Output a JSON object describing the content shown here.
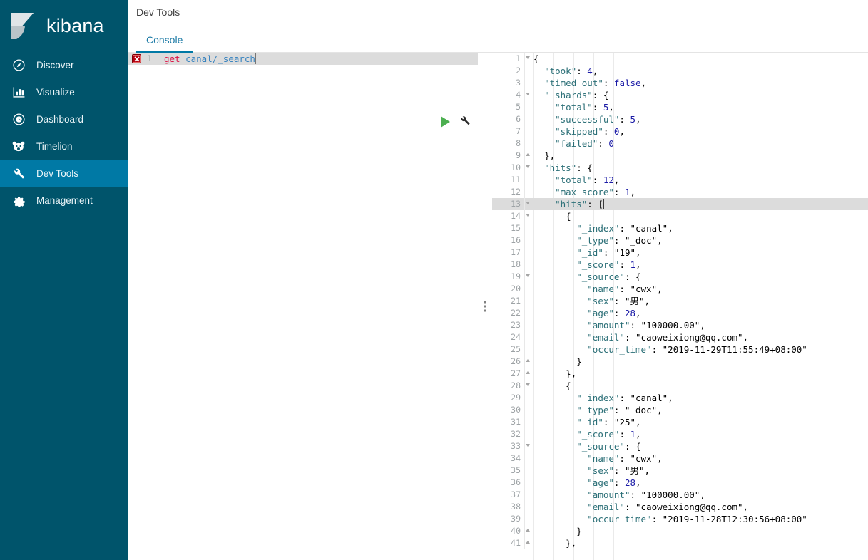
{
  "sidebar": {
    "brand": "kibana",
    "brand_icon": "kibana-logo-icon",
    "bg_color": "#00546b",
    "active_color": "#0079a5",
    "items": [
      {
        "label": "Discover",
        "icon": "compass-icon",
        "active": false
      },
      {
        "label": "Visualize",
        "icon": "bar-chart-icon",
        "active": false
      },
      {
        "label": "Dashboard",
        "icon": "clock-circle-icon",
        "active": false
      },
      {
        "label": "Timelion",
        "icon": "bear-face-icon",
        "active": false
      },
      {
        "label": "Dev Tools",
        "icon": "wrench-icon",
        "active": true
      },
      {
        "label": "Management",
        "icon": "gear-icon",
        "active": false
      }
    ]
  },
  "header": {
    "page_title": "Dev Tools"
  },
  "tabs": [
    {
      "label": "Console",
      "active": true
    }
  ],
  "request_editor": {
    "actions": {
      "play_label": "play-icon",
      "wrench_label": "wrench-icon"
    },
    "error_marker": {
      "icon": "error-x-icon",
      "line": "1"
    },
    "lines": [
      {
        "num": "1",
        "active": true,
        "error": true,
        "tokens": [
          {
            "t": "get ",
            "c": "hl-method"
          },
          {
            "t": "canal/_search",
            "c": "hl-url"
          }
        ],
        "cursor": true
      }
    ]
  },
  "splitter": {
    "handle_icon": "drag-handle-icon"
  },
  "response_editor": {
    "lines": [
      {
        "num": "1",
        "fold": "down",
        "indent": 0,
        "tokens": [
          {
            "t": "{",
            "c": "tk-punc"
          }
        ]
      },
      {
        "num": "2",
        "fold": "",
        "indent": 1,
        "tokens": [
          {
            "t": "\"took\"",
            "c": "tk-key"
          },
          {
            "t": ": ",
            "c": "tk-punc"
          },
          {
            "t": "4",
            "c": "tk-num"
          },
          {
            "t": ",",
            "c": "tk-punc"
          }
        ]
      },
      {
        "num": "3",
        "fold": "",
        "indent": 1,
        "tokens": [
          {
            "t": "\"timed_out\"",
            "c": "tk-key"
          },
          {
            "t": ": ",
            "c": "tk-punc"
          },
          {
            "t": "false",
            "c": "tk-bool"
          },
          {
            "t": ",",
            "c": "tk-punc"
          }
        ]
      },
      {
        "num": "4",
        "fold": "down",
        "indent": 1,
        "tokens": [
          {
            "t": "\"_shards\"",
            "c": "tk-key"
          },
          {
            "t": ": {",
            "c": "tk-punc"
          }
        ]
      },
      {
        "num": "5",
        "fold": "",
        "indent": 2,
        "tokens": [
          {
            "t": "\"total\"",
            "c": "tk-key"
          },
          {
            "t": ": ",
            "c": "tk-punc"
          },
          {
            "t": "5",
            "c": "tk-num"
          },
          {
            "t": ",",
            "c": "tk-punc"
          }
        ]
      },
      {
        "num": "6",
        "fold": "",
        "indent": 2,
        "tokens": [
          {
            "t": "\"successful\"",
            "c": "tk-key"
          },
          {
            "t": ": ",
            "c": "tk-punc"
          },
          {
            "t": "5",
            "c": "tk-num"
          },
          {
            "t": ",",
            "c": "tk-punc"
          }
        ]
      },
      {
        "num": "7",
        "fold": "",
        "indent": 2,
        "tokens": [
          {
            "t": "\"skipped\"",
            "c": "tk-key"
          },
          {
            "t": ": ",
            "c": "tk-punc"
          },
          {
            "t": "0",
            "c": "tk-num"
          },
          {
            "t": ",",
            "c": "tk-punc"
          }
        ]
      },
      {
        "num": "8",
        "fold": "",
        "indent": 2,
        "tokens": [
          {
            "t": "\"failed\"",
            "c": "tk-key"
          },
          {
            "t": ": ",
            "c": "tk-punc"
          },
          {
            "t": "0",
            "c": "tk-num"
          }
        ]
      },
      {
        "num": "9",
        "fold": "up",
        "indent": 1,
        "tokens": [
          {
            "t": "},",
            "c": "tk-punc"
          }
        ]
      },
      {
        "num": "10",
        "fold": "down",
        "indent": 1,
        "tokens": [
          {
            "t": "\"hits\"",
            "c": "tk-key"
          },
          {
            "t": ": {",
            "c": "tk-punc"
          }
        ]
      },
      {
        "num": "11",
        "fold": "",
        "indent": 2,
        "tokens": [
          {
            "t": "\"total\"",
            "c": "tk-key"
          },
          {
            "t": ": ",
            "c": "tk-punc"
          },
          {
            "t": "12",
            "c": "tk-num"
          },
          {
            "t": ",",
            "c": "tk-punc"
          }
        ]
      },
      {
        "num": "12",
        "fold": "",
        "indent": 2,
        "tokens": [
          {
            "t": "\"max_score\"",
            "c": "tk-key"
          },
          {
            "t": ": ",
            "c": "tk-punc"
          },
          {
            "t": "1",
            "c": "tk-num"
          },
          {
            "t": ",",
            "c": "tk-punc"
          }
        ]
      },
      {
        "num": "13",
        "fold": "down",
        "indent": 2,
        "active": true,
        "cursor": true,
        "tokens": [
          {
            "t": "\"hits\"",
            "c": "tk-key"
          },
          {
            "t": ": [",
            "c": "tk-punc"
          }
        ]
      },
      {
        "num": "14",
        "fold": "down",
        "indent": 3,
        "tokens": [
          {
            "t": "{",
            "c": "tk-punc"
          }
        ]
      },
      {
        "num": "15",
        "fold": "",
        "indent": 4,
        "tokens": [
          {
            "t": "\"_index\"",
            "c": "tk-key"
          },
          {
            "t": ": ",
            "c": "tk-punc"
          },
          {
            "t": "\"canal\"",
            "c": "tk-str"
          },
          {
            "t": ",",
            "c": "tk-punc"
          }
        ]
      },
      {
        "num": "16",
        "fold": "",
        "indent": 4,
        "tokens": [
          {
            "t": "\"_type\"",
            "c": "tk-key"
          },
          {
            "t": ": ",
            "c": "tk-punc"
          },
          {
            "t": "\"_doc\"",
            "c": "tk-str"
          },
          {
            "t": ",",
            "c": "tk-punc"
          }
        ]
      },
      {
        "num": "17",
        "fold": "",
        "indent": 4,
        "tokens": [
          {
            "t": "\"_id\"",
            "c": "tk-key"
          },
          {
            "t": ": ",
            "c": "tk-punc"
          },
          {
            "t": "\"19\"",
            "c": "tk-str"
          },
          {
            "t": ",",
            "c": "tk-punc"
          }
        ]
      },
      {
        "num": "18",
        "fold": "",
        "indent": 4,
        "tokens": [
          {
            "t": "\"_score\"",
            "c": "tk-key"
          },
          {
            "t": ": ",
            "c": "tk-punc"
          },
          {
            "t": "1",
            "c": "tk-num"
          },
          {
            "t": ",",
            "c": "tk-punc"
          }
        ]
      },
      {
        "num": "19",
        "fold": "down",
        "indent": 4,
        "tokens": [
          {
            "t": "\"_source\"",
            "c": "tk-key"
          },
          {
            "t": ": {",
            "c": "tk-punc"
          }
        ]
      },
      {
        "num": "20",
        "fold": "",
        "indent": 5,
        "tokens": [
          {
            "t": "\"name\"",
            "c": "tk-key"
          },
          {
            "t": ": ",
            "c": "tk-punc"
          },
          {
            "t": "\"cwx\"",
            "c": "tk-str"
          },
          {
            "t": ",",
            "c": "tk-punc"
          }
        ]
      },
      {
        "num": "21",
        "fold": "",
        "indent": 5,
        "tokens": [
          {
            "t": "\"sex\"",
            "c": "tk-key"
          },
          {
            "t": ": ",
            "c": "tk-punc"
          },
          {
            "t": "\"男\"",
            "c": "tk-str"
          },
          {
            "t": ",",
            "c": "tk-punc"
          }
        ]
      },
      {
        "num": "22",
        "fold": "",
        "indent": 5,
        "tokens": [
          {
            "t": "\"age\"",
            "c": "tk-key"
          },
          {
            "t": ": ",
            "c": "tk-punc"
          },
          {
            "t": "28",
            "c": "tk-num"
          },
          {
            "t": ",",
            "c": "tk-punc"
          }
        ]
      },
      {
        "num": "23",
        "fold": "",
        "indent": 5,
        "tokens": [
          {
            "t": "\"amount\"",
            "c": "tk-key"
          },
          {
            "t": ": ",
            "c": "tk-punc"
          },
          {
            "t": "\"100000.00\"",
            "c": "tk-str"
          },
          {
            "t": ",",
            "c": "tk-punc"
          }
        ]
      },
      {
        "num": "24",
        "fold": "",
        "indent": 5,
        "tokens": [
          {
            "t": "\"email\"",
            "c": "tk-key"
          },
          {
            "t": ": ",
            "c": "tk-punc"
          },
          {
            "t": "\"caoweixiong@qq.com\"",
            "c": "tk-str"
          },
          {
            "t": ",",
            "c": "tk-punc"
          }
        ]
      },
      {
        "num": "25",
        "fold": "",
        "indent": 5,
        "tokens": [
          {
            "t": "\"occur_time\"",
            "c": "tk-key"
          },
          {
            "t": ": ",
            "c": "tk-punc"
          },
          {
            "t": "\"2019-11-29T11:55:49+08:00\"",
            "c": "tk-str"
          }
        ]
      },
      {
        "num": "26",
        "fold": "up",
        "indent": 4,
        "tokens": [
          {
            "t": "}",
            "c": "tk-punc"
          }
        ]
      },
      {
        "num": "27",
        "fold": "up",
        "indent": 3,
        "tokens": [
          {
            "t": "},",
            "c": "tk-punc"
          }
        ]
      },
      {
        "num": "28",
        "fold": "down",
        "indent": 3,
        "tokens": [
          {
            "t": "{",
            "c": "tk-punc"
          }
        ]
      },
      {
        "num": "29",
        "fold": "",
        "indent": 4,
        "tokens": [
          {
            "t": "\"_index\"",
            "c": "tk-key"
          },
          {
            "t": ": ",
            "c": "tk-punc"
          },
          {
            "t": "\"canal\"",
            "c": "tk-str"
          },
          {
            "t": ",",
            "c": "tk-punc"
          }
        ]
      },
      {
        "num": "30",
        "fold": "",
        "indent": 4,
        "tokens": [
          {
            "t": "\"_type\"",
            "c": "tk-key"
          },
          {
            "t": ": ",
            "c": "tk-punc"
          },
          {
            "t": "\"_doc\"",
            "c": "tk-str"
          },
          {
            "t": ",",
            "c": "tk-punc"
          }
        ]
      },
      {
        "num": "31",
        "fold": "",
        "indent": 4,
        "tokens": [
          {
            "t": "\"_id\"",
            "c": "tk-key"
          },
          {
            "t": ": ",
            "c": "tk-punc"
          },
          {
            "t": "\"25\"",
            "c": "tk-str"
          },
          {
            "t": ",",
            "c": "tk-punc"
          }
        ]
      },
      {
        "num": "32",
        "fold": "",
        "indent": 4,
        "tokens": [
          {
            "t": "\"_score\"",
            "c": "tk-key"
          },
          {
            "t": ": ",
            "c": "tk-punc"
          },
          {
            "t": "1",
            "c": "tk-num"
          },
          {
            "t": ",",
            "c": "tk-punc"
          }
        ]
      },
      {
        "num": "33",
        "fold": "down",
        "indent": 4,
        "tokens": [
          {
            "t": "\"_source\"",
            "c": "tk-key"
          },
          {
            "t": ": {",
            "c": "tk-punc"
          }
        ]
      },
      {
        "num": "34",
        "fold": "",
        "indent": 5,
        "tokens": [
          {
            "t": "\"name\"",
            "c": "tk-key"
          },
          {
            "t": ": ",
            "c": "tk-punc"
          },
          {
            "t": "\"cwx\"",
            "c": "tk-str"
          },
          {
            "t": ",",
            "c": "tk-punc"
          }
        ]
      },
      {
        "num": "35",
        "fold": "",
        "indent": 5,
        "tokens": [
          {
            "t": "\"sex\"",
            "c": "tk-key"
          },
          {
            "t": ": ",
            "c": "tk-punc"
          },
          {
            "t": "\"男\"",
            "c": "tk-str"
          },
          {
            "t": ",",
            "c": "tk-punc"
          }
        ]
      },
      {
        "num": "36",
        "fold": "",
        "indent": 5,
        "tokens": [
          {
            "t": "\"age\"",
            "c": "tk-key"
          },
          {
            "t": ": ",
            "c": "tk-punc"
          },
          {
            "t": "28",
            "c": "tk-num"
          },
          {
            "t": ",",
            "c": "tk-punc"
          }
        ]
      },
      {
        "num": "37",
        "fold": "",
        "indent": 5,
        "tokens": [
          {
            "t": "\"amount\"",
            "c": "tk-key"
          },
          {
            "t": ": ",
            "c": "tk-punc"
          },
          {
            "t": "\"100000.00\"",
            "c": "tk-str"
          },
          {
            "t": ",",
            "c": "tk-punc"
          }
        ]
      },
      {
        "num": "38",
        "fold": "",
        "indent": 5,
        "tokens": [
          {
            "t": "\"email\"",
            "c": "tk-key"
          },
          {
            "t": ": ",
            "c": "tk-punc"
          },
          {
            "t": "\"caoweixiong@qq.com\"",
            "c": "tk-str"
          },
          {
            "t": ",",
            "c": "tk-punc"
          }
        ]
      },
      {
        "num": "39",
        "fold": "",
        "indent": 5,
        "tokens": [
          {
            "t": "\"occur_time\"",
            "c": "tk-key"
          },
          {
            "t": ": ",
            "c": "tk-punc"
          },
          {
            "t": "\"2019-11-28T12:30:56+08:00\"",
            "c": "tk-str"
          }
        ]
      },
      {
        "num": "40",
        "fold": "up",
        "indent": 4,
        "tokens": [
          {
            "t": "}",
            "c": "tk-punc"
          }
        ]
      },
      {
        "num": "41",
        "fold": "up",
        "indent": 3,
        "tokens": [
          {
            "t": "},",
            "c": "tk-punc"
          }
        ]
      }
    ]
  }
}
